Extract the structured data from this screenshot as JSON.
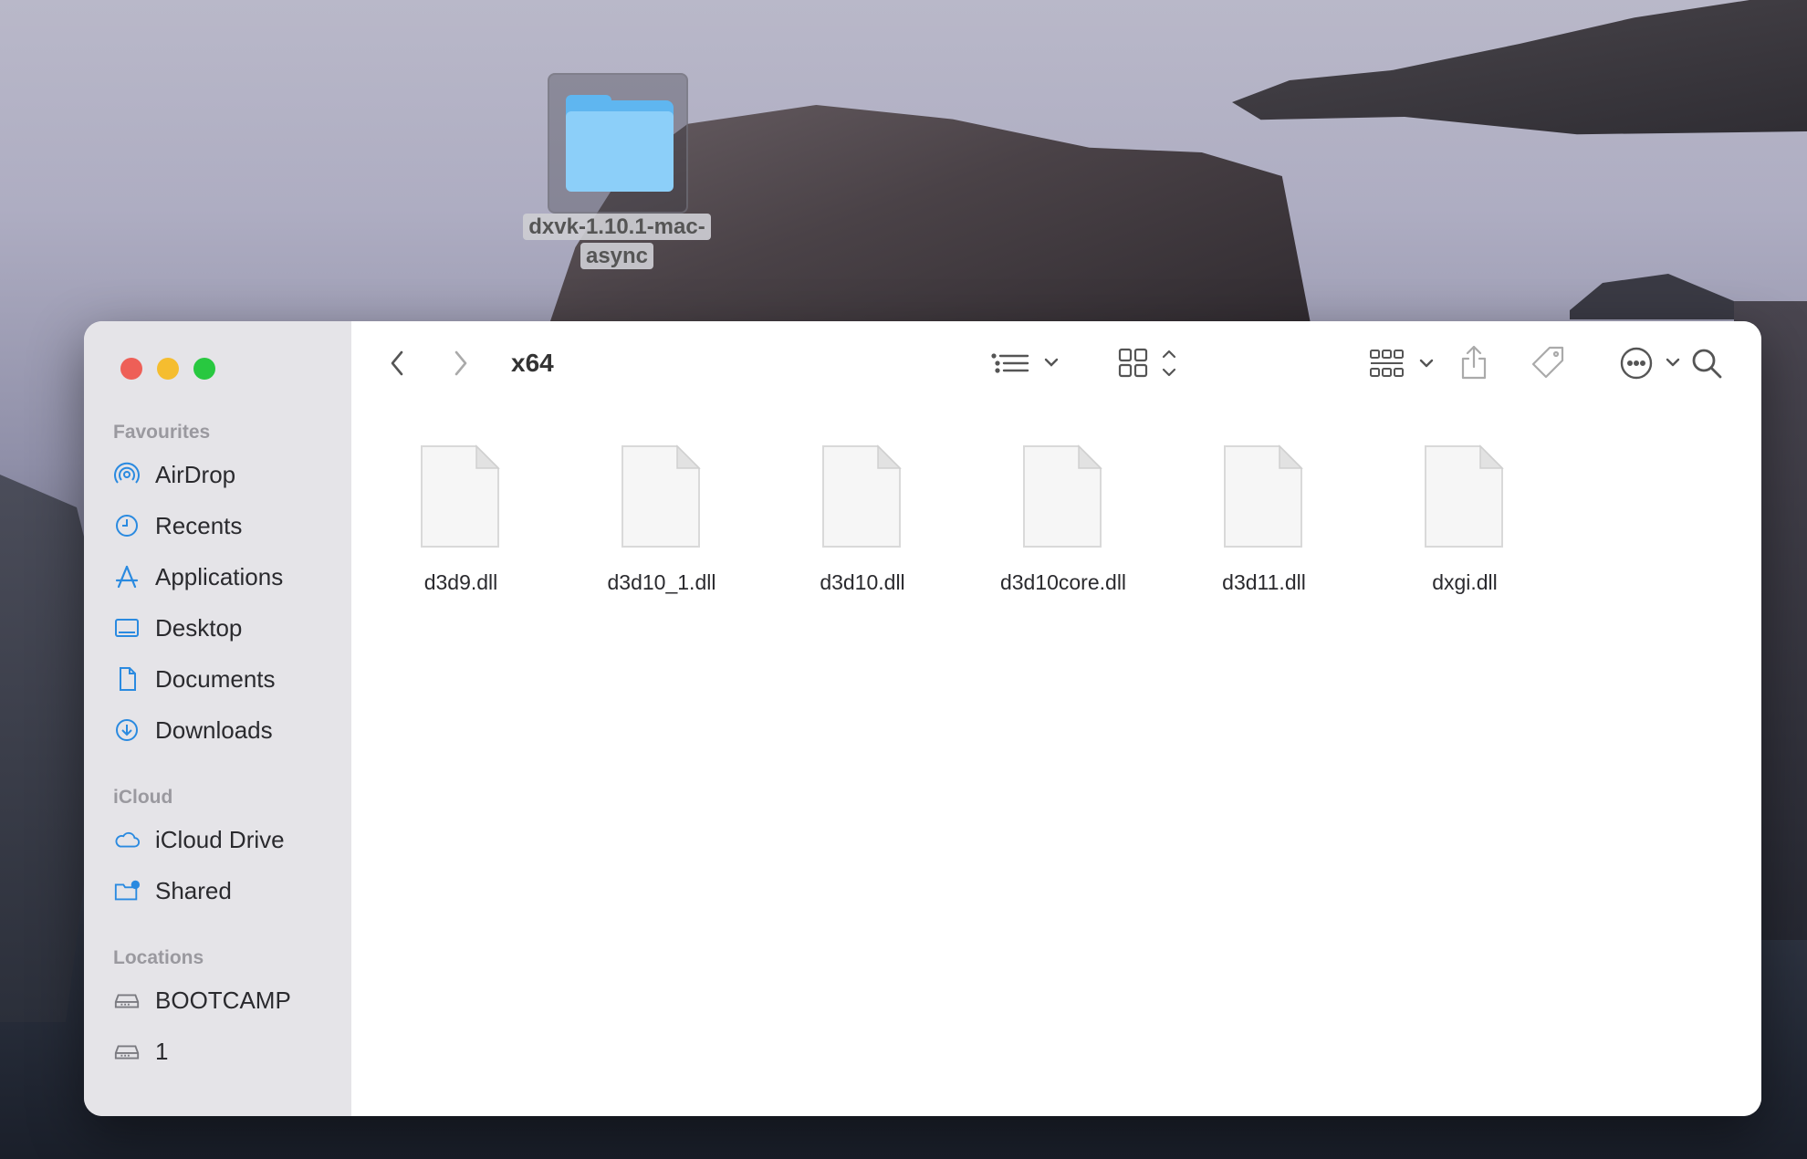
{
  "desktop": {
    "folder_name": "dxvk-1.10.1-mac-async"
  },
  "window": {
    "title": "x64",
    "colors": {
      "close": "#ee5f57",
      "minimize": "#f5bd2f",
      "zoom": "#28c840",
      "accent": "#2a8ae0"
    }
  },
  "sidebar": {
    "favourites_heading": "Favourites",
    "favourites": [
      {
        "label": "AirDrop",
        "icon": "airdrop-icon"
      },
      {
        "label": "Recents",
        "icon": "clock-icon"
      },
      {
        "label": "Applications",
        "icon": "applications-icon"
      },
      {
        "label": "Desktop",
        "icon": "desktop-icon"
      },
      {
        "label": "Documents",
        "icon": "document-icon"
      },
      {
        "label": "Downloads",
        "icon": "download-icon"
      }
    ],
    "icloud_heading": "iCloud",
    "icloud": [
      {
        "label": "iCloud Drive",
        "icon": "cloud-icon"
      },
      {
        "label": "Shared",
        "icon": "shared-folder-icon"
      }
    ],
    "locations_heading": "Locations",
    "locations": [
      {
        "label": "BOOTCAMP",
        "icon": "drive-icon"
      },
      {
        "label": "1",
        "icon": "drive-icon"
      }
    ]
  },
  "files": [
    {
      "name": "d3d9.dll"
    },
    {
      "name": "d3d10_1.dll"
    },
    {
      "name": "d3d10.dll"
    },
    {
      "name": "d3d10core.dll"
    },
    {
      "name": "d3d11.dll"
    },
    {
      "name": "dxgi.dll"
    }
  ]
}
